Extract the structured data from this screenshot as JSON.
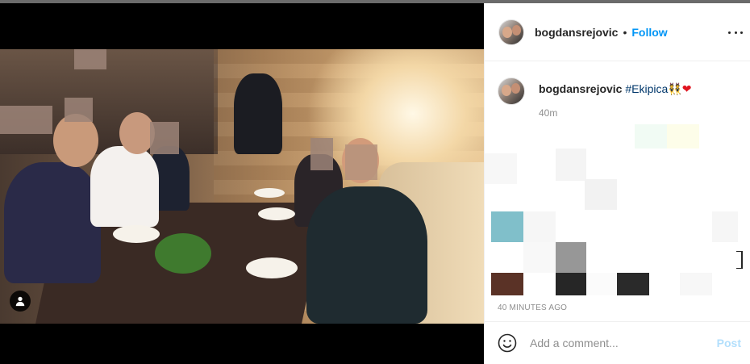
{
  "post": {
    "username": "bogdansrejovic",
    "follow_label": "Follow",
    "separator": "•",
    "more_icon": "more-horizontal-icon",
    "caption_hashtag": "#Ekipica",
    "caption_emojis": "👯",
    "caption_heart": "❤",
    "caption_age": "40m",
    "timestamp": "40 MINUTES AGO"
  },
  "comment": {
    "placeholder": "Add a comment...",
    "post_label": "Post",
    "emoji_icon": "smiley-icon"
  },
  "media": {
    "user_tag_icon": "user-tag-icon"
  },
  "colors": {
    "accent": "#0095f6",
    "hashtag": "#00376b",
    "post_disabled": "#b2dffc",
    "muted": "#8e8e8e"
  }
}
